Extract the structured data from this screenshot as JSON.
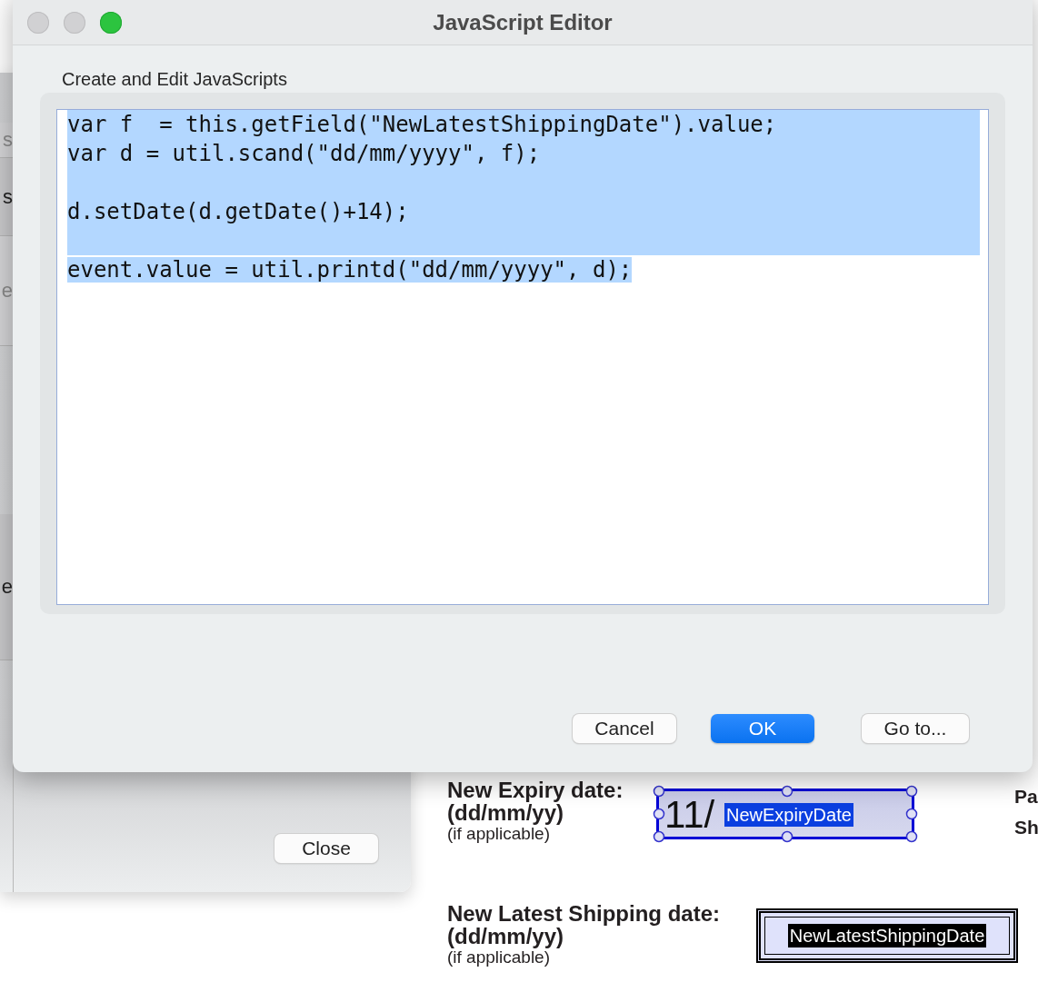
{
  "back_panel": {
    "list_items": [
      {
        "label": "s",
        "disabled": true
      },
      {
        "label": "s",
        "disabled": false
      },
      {
        "label": "e",
        "disabled": true
      },
      {
        "label": "e",
        "disabled": false
      }
    ],
    "close_button": "Close"
  },
  "form": {
    "fields": [
      {
        "label": "New Expiry date:",
        "format": "(dd/mm/yy)",
        "hint": "(if applicable)",
        "value": "11/",
        "tag": "NewExpiryDate",
        "selected": true
      },
      {
        "label": "New Latest Shipping date:",
        "format": "(dd/mm/yy)",
        "hint": "(if applicable)",
        "tag": "NewLatestShippingDate",
        "selected": false
      }
    ],
    "side_labels": [
      "Pa",
      "Sh"
    ]
  },
  "dialog": {
    "title": "JavaScript Editor",
    "heading": "Create and Edit JavaScripts",
    "selected": true,
    "code_lines": [
      {
        "kind": "code",
        "text": "var f  = this.getField(\"NewLatestShippingDate\").value;"
      },
      {
        "kind": "code",
        "text": "var d = util.scand(\"dd/mm/yyyy\", f);"
      },
      {
        "kind": "blank"
      },
      {
        "kind": "code",
        "text": "d.setDate(d.getDate()+14);"
      },
      {
        "kind": "blank"
      },
      {
        "kind": "code",
        "text": "event.value = util.printd(\"dd/mm/yyyy\", d);"
      }
    ],
    "buttons": [
      {
        "label": "Cancel",
        "default": false
      },
      {
        "label": "OK",
        "default": true
      },
      {
        "label": "Go to...",
        "default": false
      }
    ]
  }
}
